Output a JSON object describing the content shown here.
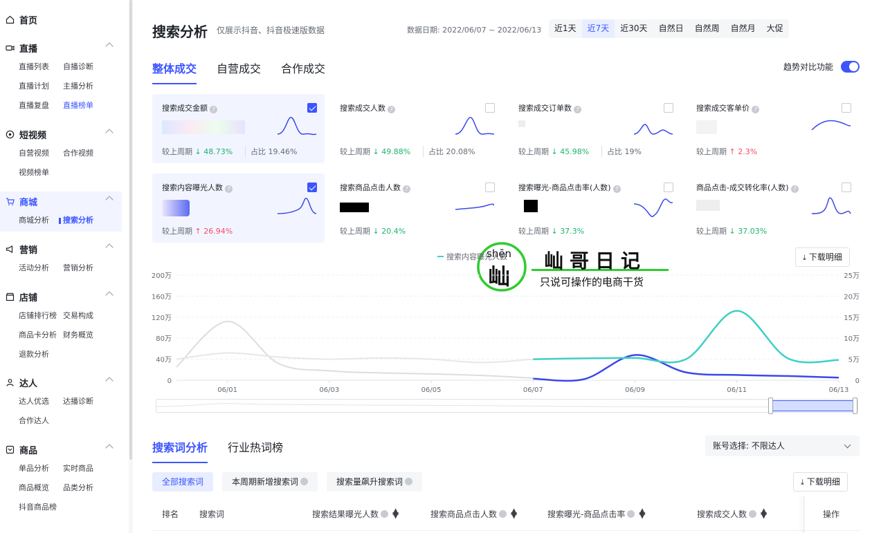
{
  "sidebar": {
    "groups": [
      {
        "title": "首页",
        "items": []
      },
      {
        "title": "直播",
        "items": [
          "直播列表",
          "自播诊断",
          "直播计划",
          "主播分析",
          "直播复盘",
          "直播榜单"
        ],
        "selected": "直播榜单"
      },
      {
        "title": "短视频",
        "items": [
          "自营视频",
          "合作视频",
          "视频榜单"
        ]
      },
      {
        "title": "商城",
        "items": [
          "商城分析",
          "搜索分析"
        ],
        "selected": "搜索分析"
      },
      {
        "title": "营销",
        "items": [
          "活动分析",
          "营销分析"
        ]
      },
      {
        "title": "店铺",
        "items": [
          "店铺排行榜",
          "交易构成",
          "商品卡分析",
          "财务概览",
          "退款分析"
        ]
      },
      {
        "title": "达人",
        "items": [
          "达人优选",
          "达播诊断",
          "合作达人"
        ]
      },
      {
        "title": "商品",
        "items": [
          "单品分析",
          "实时商品",
          "商品概览",
          "品类分析",
          "抖音商品榜"
        ]
      }
    ]
  },
  "header": {
    "title": "搜索分析",
    "subtitle": "仅展示抖音、抖音极速版数据",
    "date": "数据日期: 2022/06/07 ~ 2022/06/13",
    "periods": [
      "近1天",
      "近7天",
      "近30天",
      "自然日",
      "自然周",
      "自然月",
      "大促"
    ],
    "period_selected": "近7天"
  },
  "tabs": [
    "整体成交",
    "自营成交",
    "合作成交"
  ],
  "trend_label": "趋势对比功能",
  "cards": [
    {
      "label": "搜索成交金额",
      "checked": true,
      "cmp_label": "较上周期",
      "cmp_dir": "down",
      "cmp": "48.73%",
      "share": "占比 19.46%"
    },
    {
      "label": "搜索成交人数",
      "checked": false,
      "cmp_label": "较上周期",
      "cmp_dir": "down",
      "cmp": "49.88%",
      "share": "占比 20.08%"
    },
    {
      "label": "搜索成交订单数",
      "checked": false,
      "cmp_label": "较上周期",
      "cmp_dir": "down",
      "cmp": "45.98%",
      "share": "占比 19%"
    },
    {
      "label": "搜索成交客单价",
      "checked": false,
      "cmp_label": "较上周期",
      "cmp_dir": "up",
      "cmp": "2.3%",
      "share": ""
    },
    {
      "label": "搜索内容曝光人数",
      "checked": true,
      "cmp_label": "较上周期",
      "cmp_dir": "up",
      "cmp": "26.94%",
      "share": ""
    },
    {
      "label": "搜索商品点击人数",
      "checked": false,
      "cmp_label": "较上周期",
      "cmp_dir": "down",
      "cmp": "20.4%",
      "share": ""
    },
    {
      "label": "搜索曝光-商品点击率(人数)",
      "checked": false,
      "cmp_label": "较上周期",
      "cmp_dir": "down",
      "cmp": "37.3%",
      "share": ""
    },
    {
      "label": "商品点击-成交转化率(人数)",
      "checked": false,
      "cmp_label": "较上周期",
      "cmp_dir": "down",
      "cmp": "37.03%",
      "share": ""
    }
  ],
  "legend": "搜索内容曝光人数",
  "download_label": "下载明细",
  "chart_data": {
    "type": "line",
    "x": [
      "05/31",
      "06/01",
      "06/02",
      "06/03",
      "06/04",
      "06/05",
      "06/06",
      "06/07",
      "06/08",
      "06/09",
      "06/10",
      "06/11",
      "06/12",
      "06/13"
    ],
    "x_ticks": [
      "06/01",
      "06/03",
      "06/05",
      "06/07",
      "06/09",
      "06/11",
      "06/13"
    ],
    "y_left_ticks": [
      "0",
      "40万",
      "80万",
      "120万",
      "160万",
      "200万"
    ],
    "y_right_ticks": [
      "0",
      "5万",
      "10万",
      "15万",
      "20万",
      "25万"
    ],
    "ylim_left": [
      0,
      200
    ],
    "ylim_right": [
      0,
      25
    ],
    "series": [
      {
        "axis": "left",
        "period": "previous",
        "color": "#dcdde0",
        "values": [
          25,
          112,
          32,
          18,
          14,
          12,
          9,
          4
        ]
      },
      {
        "axis": "left",
        "period": "current",
        "color": "#3c48e8",
        "values": [
          null,
          null,
          null,
          null,
          null,
          null,
          null,
          3,
          2,
          48,
          15,
          10,
          8,
          5
        ]
      },
      {
        "axis": "right",
        "period": "previous",
        "color": "#e6e7ea",
        "values": [
          5,
          6.5,
          5.5,
          5,
          5.3,
          5,
          4.2,
          5
        ]
      },
      {
        "axis": "right",
        "period": "current",
        "color": "#3ecfc6",
        "values": [
          null,
          null,
          null,
          null,
          null,
          null,
          null,
          5,
          5.2,
          5.3,
          5,
          16.5,
          5.2,
          4.8
        ]
      }
    ]
  },
  "watermark": {
    "pinyin": "shēn",
    "char": "屾",
    "brand": "屾哥日记",
    "slogan": "只说可操作的电商干货"
  },
  "section2": {
    "tabs": [
      "搜索词分析",
      "行业热词榜"
    ],
    "account_label": "账号选择: 不限达人",
    "filters": [
      "全部搜索词",
      "本周期新增搜索词",
      "搜索量飙升搜索词"
    ],
    "columns": [
      "排名",
      "搜索词",
      "搜索结果曝光人数",
      "搜索商品点击人数",
      "搜索曝光-商品点击率",
      "搜索成交人数",
      "操作"
    ]
  },
  "colors": {
    "accent": "#3c55ff",
    "down": "#1fb36f",
    "up": "#f54a6a"
  }
}
